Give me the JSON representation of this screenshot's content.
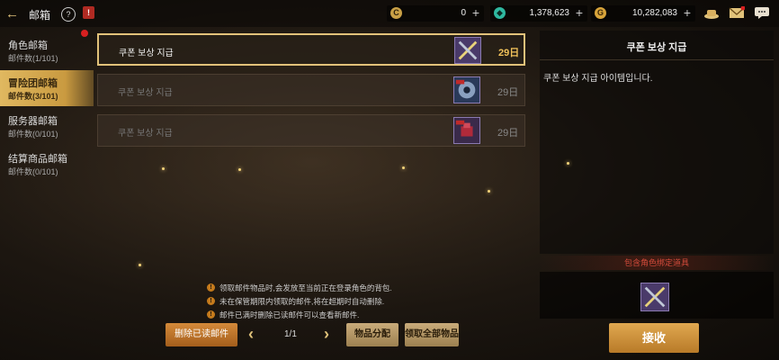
{
  "header": {
    "title": "邮箱",
    "help_icon": "help-icon",
    "calendar_icon": "calendar-icon"
  },
  "currencies": [
    {
      "icon": "coin-c-icon",
      "value": "0",
      "color": "#c9a046"
    },
    {
      "icon": "gem-icon",
      "value": "1,378,623",
      "color": "#2fb8a0"
    },
    {
      "icon": "gold-coin-icon",
      "value": "10,282,083",
      "color": "#d8a43a"
    }
  ],
  "top_icons": [
    "hat-icon",
    "mail-icon",
    "chat-icon"
  ],
  "sidebar": {
    "items": [
      {
        "label": "角色邮箱",
        "count": "邮件数(1/101)",
        "active": false
      },
      {
        "label": "冒险团邮箱",
        "count": "邮件数(3/101)",
        "active": true
      },
      {
        "label": "服务器邮箱",
        "count": "邮件数(0/101)",
        "active": false
      },
      {
        "label": "结算商品邮箱",
        "count": "邮件数(0/101)",
        "active": false
      }
    ]
  },
  "mails": [
    {
      "title": "쿠폰 보상 지급",
      "days": "29日",
      "selected": true
    },
    {
      "title": "쿠폰 보상 지급",
      "days": "29日",
      "selected": false
    },
    {
      "title": "쿠폰 보상 지급",
      "days": "29日",
      "selected": false
    }
  ],
  "detail": {
    "title": "쿠폰 보상 지급",
    "body": "쿠폰 보상 지급 아이템입니다.",
    "bind_header": "包含角色绑定道具"
  },
  "notes": [
    "领取邮件物品时,会发放至当前正在登录角色的背包.",
    "未在保管期限内领取的邮件,将在超期时自动删除.",
    "邮件已满时删除已读邮件可以查看新邮件."
  ],
  "buttons": {
    "delete_read": "删除已读邮件",
    "pager": "1/1",
    "distribute": "物品分配",
    "claim_all": "领取全部物品",
    "receive": "接收"
  }
}
